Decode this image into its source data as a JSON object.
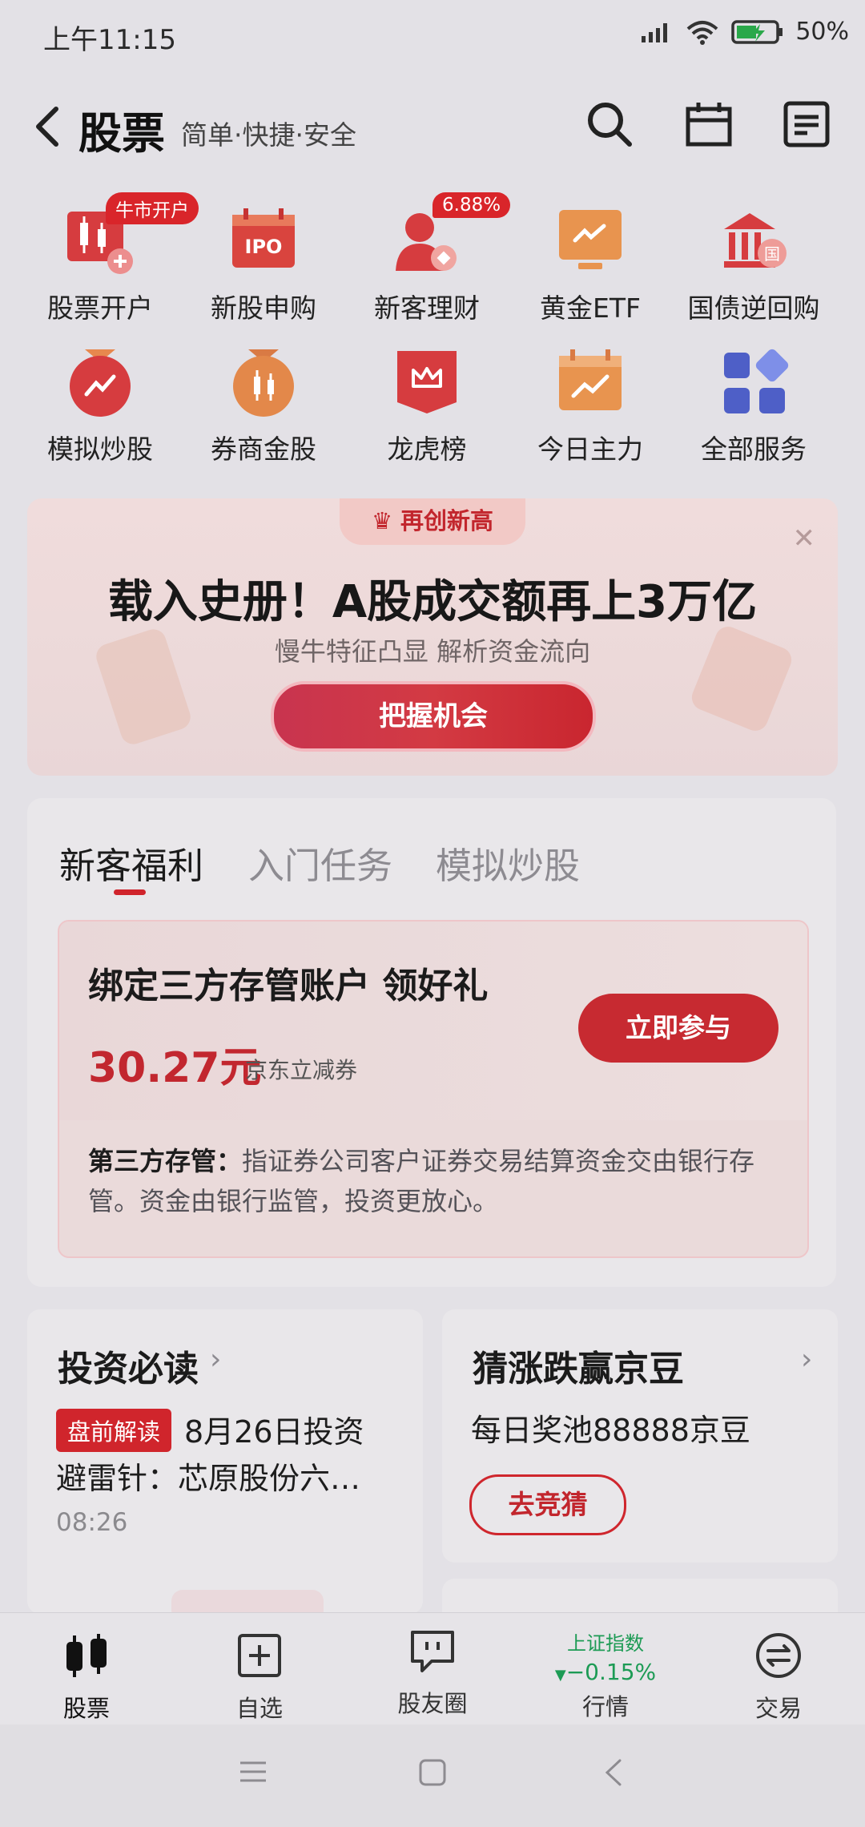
{
  "status_bar": {
    "time": "上午11:15",
    "battery": "50%"
  },
  "header": {
    "title": "股票",
    "subtitle": "简单·快捷·安全"
  },
  "services": [
    {
      "label": "股票开户",
      "badge": "牛市开户",
      "icon": "candlestick-icon"
    },
    {
      "label": "新股申购",
      "badge": "",
      "icon": "ipo-icon"
    },
    {
      "label": "新客理财",
      "badge": "6.88%",
      "icon": "wealth-user-icon"
    },
    {
      "label": "黄金ETF",
      "badge": "",
      "icon": "gold-etf-icon"
    },
    {
      "label": "国债逆回购",
      "badge": "",
      "icon": "treasury-bank-icon"
    },
    {
      "label": "模拟炒股",
      "badge": "",
      "icon": "simulated-trade-icon"
    },
    {
      "label": "券商金股",
      "badge": "",
      "icon": "broker-stock-icon"
    },
    {
      "label": "龙虎榜",
      "badge": "",
      "icon": "dragon-tiger-list-icon"
    },
    {
      "label": "今日主力",
      "badge": "",
      "icon": "main-force-icon"
    },
    {
      "label": "全部服务",
      "badge": "",
      "icon": "all-services-icon"
    }
  ],
  "banner": {
    "tag": "再创新高",
    "headline": "载入史册！A股成交额再上3万亿",
    "subline": "慢牛特征凸显 解析资金流向",
    "button": "把握机会"
  },
  "welfare": {
    "tabs": [
      "新客福利",
      "入门任务",
      "模拟炒股"
    ],
    "card": {
      "title": "绑定三方存管账户 领好礼",
      "amount": "30.27元",
      "amount_note": "京东立减券",
      "button": "立即参与",
      "desc_label": "第三方存管：",
      "desc_text": "指证券公司客户证券交易结算资金交由银行存管。资金由银行监管，投资更放心。"
    }
  },
  "must_read": {
    "title": "投资必读",
    "tag": "盘前解读",
    "line1": "8月26日投资",
    "line2": "避雷针：芯原股份六…",
    "time": "08:26"
  },
  "guess": {
    "title": "猜涨跌赢京豆",
    "subtitle": "每日奖池88888京豆",
    "button": "去竞猜"
  },
  "bottom_nav": {
    "stocks": "股票",
    "watchlist": "自选",
    "community": "股友圈",
    "market_index": "上证指数",
    "market_change": "−0.15%",
    "market": "行情",
    "trade": "交易"
  },
  "colors": {
    "accent": "#d0242c",
    "down": "#1d9b55"
  }
}
